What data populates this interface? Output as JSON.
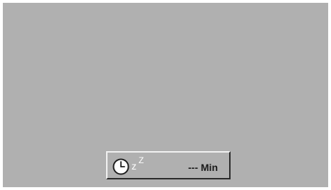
{
  "sleep_timer": {
    "icon": "clock-icon",
    "zzz_first": "z",
    "zzz_second": "Z",
    "value": "---",
    "unit": "Min"
  },
  "colors": {
    "screen_background": "#b0b0b0",
    "text": "#1a1a1a",
    "zzz": "#ffffff"
  }
}
